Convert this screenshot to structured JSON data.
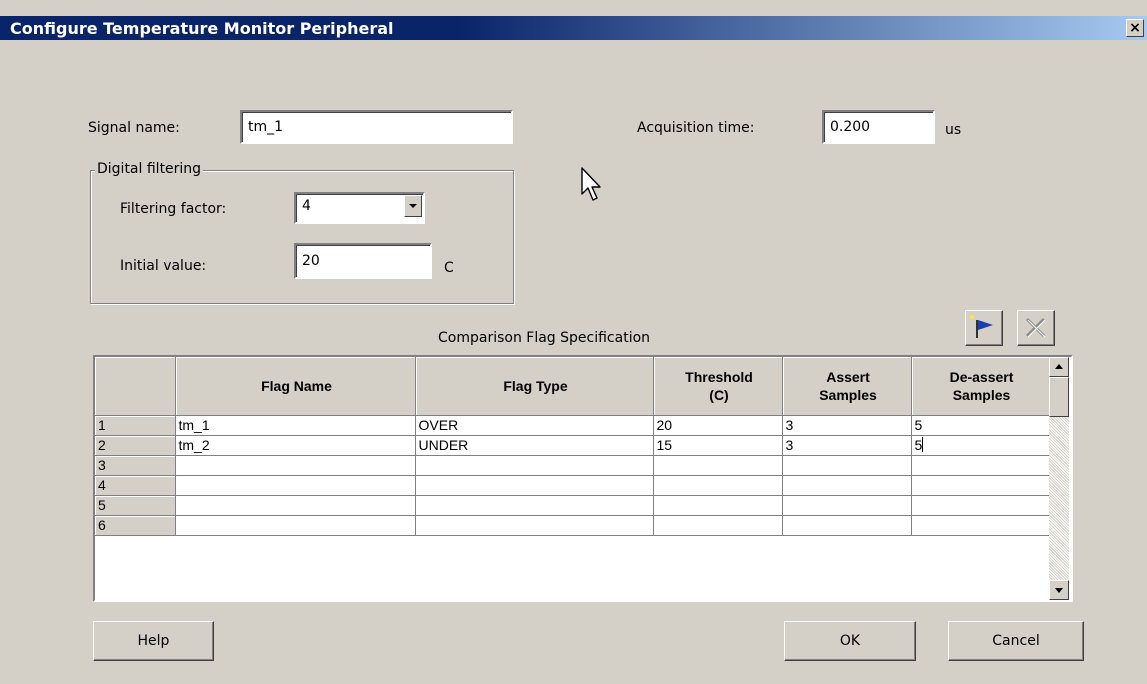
{
  "window": {
    "title": "Configure Temperature Monitor Peripheral",
    "close_glyph": "×"
  },
  "form": {
    "signal_name_label": "Signal name:",
    "signal_name_value": "tm_1",
    "acquisition_label": "Acquisition  time:",
    "acquisition_value": "0.200",
    "acquisition_unit": "us",
    "digital_filtering": {
      "legend": "Digital filtering",
      "filter_factor_label": "Filtering factor:",
      "filter_factor_value": "4",
      "initial_value_label": "Initial value:",
      "initial_value_value": "20",
      "initial_value_unit": "C"
    }
  },
  "flags": {
    "caption": "Comparison Flag Specification",
    "add_icon": "add-flag-icon",
    "delete_icon": "delete-flag-icon",
    "columns": {
      "flag_name": "Flag Name",
      "flag_type": "Flag Type",
      "threshold_1": "Threshold",
      "threshold_2": "(C)",
      "assert_1": "Assert",
      "assert_2": "Samples",
      "deassert_1": "De-assert",
      "deassert_2": "Samples"
    },
    "rows": [
      {
        "num": "1",
        "name": "tm_1",
        "type": "OVER",
        "threshold": "20",
        "assert": "3",
        "deassert": "5"
      },
      {
        "num": "2",
        "name": "tm_2",
        "type": "UNDER",
        "threshold": "15",
        "assert": "3",
        "deassert": "5"
      },
      {
        "num": "3",
        "name": "",
        "type": "",
        "threshold": "",
        "assert": "",
        "deassert": ""
      },
      {
        "num": "4",
        "name": "",
        "type": "",
        "threshold": "",
        "assert": "",
        "deassert": ""
      },
      {
        "num": "5",
        "name": "",
        "type": "",
        "threshold": "",
        "assert": "",
        "deassert": ""
      },
      {
        "num": "6",
        "name": "",
        "type": "",
        "threshold": "",
        "assert": "",
        "deassert": ""
      }
    ]
  },
  "buttons": {
    "help": "Help",
    "ok": "OK",
    "cancel": "Cancel"
  }
}
